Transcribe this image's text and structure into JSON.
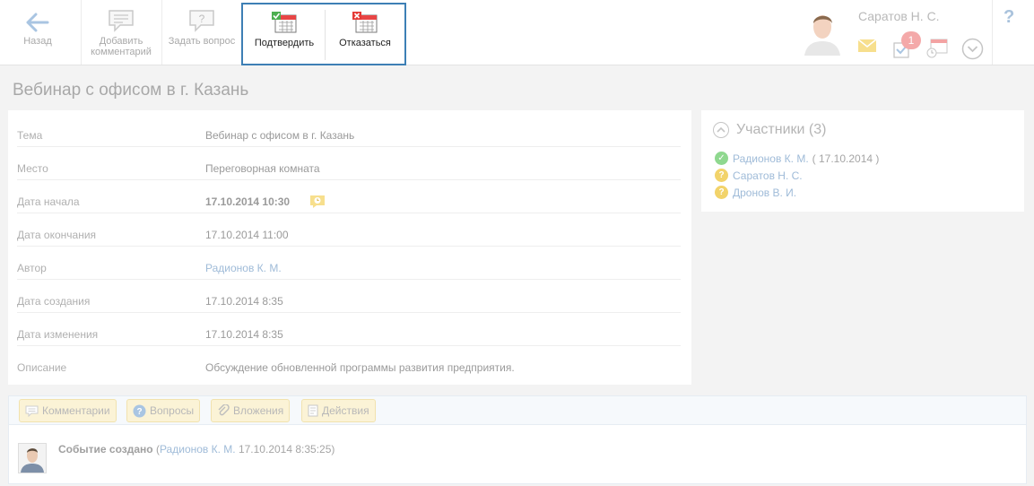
{
  "toolbar": {
    "back_label": "Назад",
    "add_comment_label": "Добавить комментарий",
    "ask_question_label": "Задать вопрос",
    "confirm_label": "Подтвердить",
    "decline_label": "Отказаться"
  },
  "header": {
    "user_name": "Саратов Н. С.",
    "tasks_badge": "1",
    "help_label": "?"
  },
  "page": {
    "title": "Вебинар с офисом в г. Казань"
  },
  "details": [
    {
      "label": "Тема",
      "value": "Вебинар с офисом в г. Казань"
    },
    {
      "label": "Место",
      "value": "Переговорная комната"
    },
    {
      "label": "Дата начала",
      "value": "17.10.2014 10:30"
    },
    {
      "label": "Дата окончания",
      "value": "17.10.2014 11:00"
    },
    {
      "label": "Автор",
      "value": "Радионов К. М."
    },
    {
      "label": "Дата создания",
      "value": "17.10.2014 8:35"
    },
    {
      "label": "Дата изменения",
      "value": "17.10.2014 8:35"
    },
    {
      "label": "Описание",
      "value": "Обсуждение обновленной программы развития предприятия."
    }
  ],
  "participants": {
    "title": "Участники (3)",
    "items": [
      {
        "name": "Радионов К. М.",
        "date": "( 17.10.2014 )",
        "status": "confirmed"
      },
      {
        "name": "Саратов Н. С.",
        "date": "",
        "status": "pending"
      },
      {
        "name": "Дронов В. И.",
        "date": "",
        "status": "pending"
      }
    ]
  },
  "tabs": {
    "comments": "Комментарии",
    "questions": "Вопросы",
    "attachments": "Вложения",
    "actions": "Действия"
  },
  "event": {
    "title": "Событие создано",
    "open_paren": "(",
    "author": "Радионов К. М.",
    "timestamp": "17.10.2014 8:35:25)"
  },
  "colors": {
    "focus_border": "#3d7fb5",
    "link": "#9fbbd8",
    "confirmed": "#8fd88f",
    "pending": "#f2d36a",
    "badge": "#f4a9a9"
  },
  "icons": {
    "back": "arrow-left-icon",
    "comment": "speech-bubble-icon",
    "question": "question-bubble-icon",
    "confirm": "calendar-check-icon",
    "decline": "calendar-cross-icon",
    "mail": "envelope-icon",
    "tasks": "checklist-icon",
    "calendar": "calendar-icon",
    "menu": "chevron-down-icon",
    "reminder": "alarm-clock-icon"
  }
}
